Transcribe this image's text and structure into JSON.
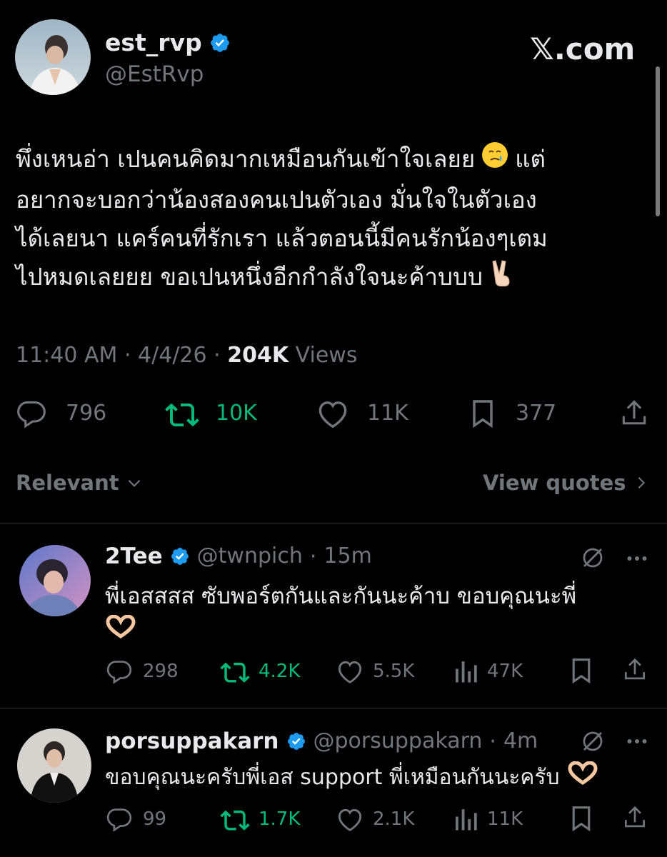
{
  "watermark": "𝕏.com",
  "tweet": {
    "author": {
      "display_name": "est_rvp",
      "handle": "@EstRvp",
      "verified": true
    },
    "text_lines": [
      "พึ่งเหนอ่า เปนคนคิดมากเหมือนกันเข้าใจเลยย",
      "แต่",
      "อยากจะบอกว่าน้องสองคนเปนตัวเอง มั่นใจในตัวเอง",
      "ได้เลยนา แคร์คนที่รักเรา แล้วตอนนี้มีคนรักน้องๆเตม",
      "ไปหมดเลยยย ขอเปนหนึ่งอีกกำลังใจนะค้าบบบ"
    ],
    "emojis": [
      "holding-back-tears-emoji",
      "victory-hand-emoji"
    ],
    "time": "11:40 AM",
    "date": "4/4/26",
    "views_count": "204K",
    "views_label": "Views",
    "stats": {
      "replies": "796",
      "reposts": "10K",
      "likes": "11K",
      "bookmarks": "377"
    }
  },
  "sort": {
    "label": "Relevant",
    "view_quotes": "View quotes"
  },
  "replies": [
    {
      "display_name": "2Tee",
      "handle": "@twnpich",
      "time": "15m",
      "verified": true,
      "text_lines": [
        "พี่เอสสสส ซับพอร์ตกันและกันนะค้าบ ขอบคุณนะพี่"
      ],
      "stats": {
        "replies": "298",
        "reposts": "4.2K",
        "likes": "5.5K",
        "views": "47K"
      }
    },
    {
      "display_name": "porsuppakarn",
      "handle": "@porsuppakarn",
      "time": "4m",
      "verified": true,
      "text_lines": [
        "ขอบคุณนะครับพี่เอส support พี่เหมือนกันนะครับ"
      ],
      "stats": {
        "replies": "99",
        "reposts": "1.7K",
        "likes": "2.1K",
        "views": "11K"
      }
    }
  ],
  "colors": {
    "background": "#000000",
    "text": "#e7e9ea",
    "secondary": "#71767b",
    "accent": "#1d9bf0",
    "repost": "#00ba7c"
  }
}
